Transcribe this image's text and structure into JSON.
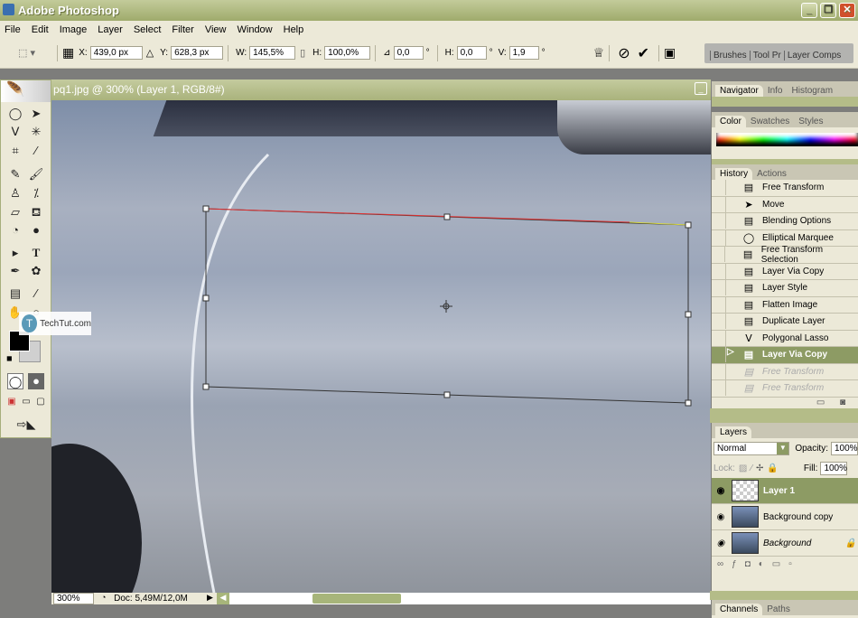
{
  "app": {
    "title": "Adobe Photoshop",
    "window_controls": [
      "_",
      "❐",
      "✕"
    ]
  },
  "menu": [
    "File",
    "Edit",
    "Image",
    "Layer",
    "Select",
    "Filter",
    "View",
    "Window",
    "Help"
  ],
  "options": {
    "x_label": "X:",
    "x": "439,0 px",
    "y_label": "Y:",
    "y": "628,3 px",
    "w_label": "W:",
    "w": "145,5%",
    "h_label": "H:",
    "h": "100,0%",
    "rot": "0,0",
    "hskew_label": "H:",
    "hskew": "0,0",
    "vskew_label": "V:",
    "vskew": "1,9",
    "deg": "°"
  },
  "wells": [
    "Brushes",
    "Tool Pr",
    "Layer Comps"
  ],
  "document": {
    "title": "pq1.jpg @ 300% (Layer 1, RGB/8#)",
    "zoom": "300%",
    "doc_size": "Doc: 5,49M/12,0M"
  },
  "watermark": "TechTut.com",
  "navigator_tabs": [
    "Navigator",
    "Info",
    "Histogram"
  ],
  "color_tabs": [
    "Color",
    "Swatches",
    "Styles"
  ],
  "history_tabs": [
    "History",
    "Actions"
  ],
  "history": [
    {
      "label": "Free Transform",
      "icon": "doc"
    },
    {
      "label": "Move",
      "icon": "move"
    },
    {
      "label": "Blending Options",
      "icon": "doc"
    },
    {
      "label": "Elliptical Marquee",
      "icon": "ellipse"
    },
    {
      "label": "Free Transform Selection",
      "icon": "doc"
    },
    {
      "label": "Layer Via Copy",
      "icon": "doc"
    },
    {
      "label": "Layer Style",
      "icon": "doc"
    },
    {
      "label": "Flatten Image",
      "icon": "doc"
    },
    {
      "label": "Duplicate Layer",
      "icon": "doc"
    },
    {
      "label": "Polygonal Lasso",
      "icon": "lasso"
    },
    {
      "label": "Layer Via Copy",
      "icon": "doc",
      "state": "selected"
    },
    {
      "label": "Free Transform",
      "icon": "doc",
      "state": "dim"
    },
    {
      "label": "Free Transform",
      "icon": "doc",
      "state": "dim"
    }
  ],
  "layers": {
    "tab": "Layers",
    "blend_mode": "Normal",
    "opacity_label": "Opacity:",
    "opacity": "100%",
    "lock_label": "Lock:",
    "fill_label": "Fill:",
    "fill": "100%",
    "items": [
      {
        "name": "Layer 1",
        "selected": true
      },
      {
        "name": "Background copy"
      },
      {
        "name": "Background",
        "italic": true,
        "locked": true
      }
    ]
  },
  "bottom_tabs": [
    "Channels",
    "Paths"
  ],
  "colors": {
    "accent": "#8d9b64",
    "foreground": "#000000",
    "background": "#d0d0d0",
    "transform_top": "#e03030"
  }
}
